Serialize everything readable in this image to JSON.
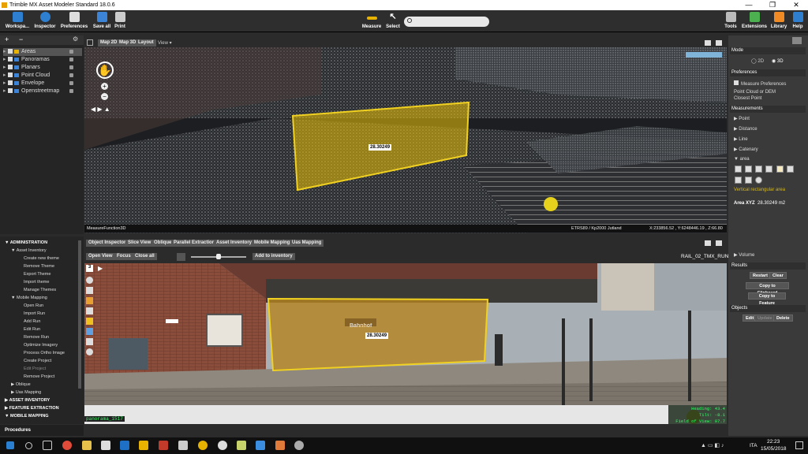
{
  "titlebar": {
    "title": "Trimble MX Asset Modeler Standard 18.0.6",
    "minimize": "—",
    "maximize": "❐",
    "close": "✕"
  },
  "toolbar": {
    "left": [
      "Workspa...",
      "Inspector",
      "Preferences",
      "Save all",
      "Print"
    ],
    "measure": "Measure",
    "select": "Select",
    "search_placeholder": "",
    "right": [
      "Tools",
      "Extensions",
      "Library",
      "Help"
    ]
  },
  "layers": [
    {
      "label": "Areas",
      "selected": true
    },
    {
      "label": "Panoramas"
    },
    {
      "label": "Planars"
    },
    {
      "label": "Point Cloud"
    },
    {
      "label": "Envelope"
    },
    {
      "label": "Openstreetmap"
    }
  ],
  "view3d": {
    "tabs": [
      "Map 2D",
      "Map 3D",
      "Layout"
    ],
    "view_menu": "View",
    "area_label": "28.30249",
    "status_left": "MeasureFunction3D",
    "status_crs": "ETRS89 / Kp2000 Jutland",
    "status_coords": "X:233856.52 , Y:6248446.19 , Z:66.80"
  },
  "right": {
    "mode": "Mode",
    "mode_2d": "2D",
    "mode_3d": "3D",
    "preferences": "Preferences",
    "measure_prefs": "Measure Preferences",
    "pref_line1": "Point Cloud or DEM",
    "pref_line2": "Closest Point",
    "measurements": "Measurements",
    "items": [
      "Point",
      "Distance",
      "Line",
      "Catenary",
      "area"
    ],
    "area_type": "Vertical rectangular area",
    "area_result_label": "Area XYZ",
    "area_result_value": "28.30249 m2",
    "volume": "Volume",
    "results": "Results",
    "restart": "Restart",
    "clear": "Clear",
    "copy_clip": "Copy to Clipboard",
    "copy_feat": "Copy to Feature",
    "objects": "Objects",
    "edit": "Edit",
    "update": "Update",
    "delete": "Delete"
  },
  "tree": [
    {
      "label": "ADMINISTRATION",
      "bold": true,
      "lvl": 0,
      "arrow": "▼"
    },
    {
      "label": "Asset Inventory",
      "lvl": 1,
      "arrow": "▼"
    },
    {
      "label": "Create new theme",
      "lvl": 2
    },
    {
      "label": "Remove Theme",
      "lvl": 2
    },
    {
      "label": "Export Theme",
      "lvl": 2
    },
    {
      "label": "Import theme",
      "lvl": 2
    },
    {
      "label": "Manage Themes",
      "lvl": 2
    },
    {
      "label": "Mobile Mapping",
      "lvl": 1,
      "arrow": "▼"
    },
    {
      "label": "Open Run",
      "lvl": 2
    },
    {
      "label": "Import Run",
      "lvl": 2
    },
    {
      "label": "Add Run",
      "lvl": 2
    },
    {
      "label": "Edit Run",
      "lvl": 2
    },
    {
      "label": "Remove Run",
      "lvl": 2
    },
    {
      "label": "Optimize Imagery",
      "lvl": 2
    },
    {
      "label": "Process Ortho Image",
      "lvl": 2
    },
    {
      "label": "Create Project",
      "lvl": 2
    },
    {
      "label": "Edit Project",
      "lvl": 2
    },
    {
      "label": "Remove Project",
      "lvl": 2
    },
    {
      "label": "Oblique",
      "lvl": 1,
      "arrow": "▶"
    },
    {
      "label": "Uas Mapping",
      "lvl": 1,
      "arrow": "▶"
    },
    {
      "label": "ASSET INVENTORY",
      "bold": true,
      "lvl": 0,
      "arrow": "▶"
    },
    {
      "label": "FEATURE EXTRACTION",
      "bold": true,
      "lvl": 0,
      "arrow": "▶"
    },
    {
      "label": "MOBILE MAPPING",
      "bold": true,
      "lvl": 0,
      "arrow": "▼"
    }
  ],
  "procedures": "Procedures",
  "bottom": {
    "tabs": [
      "Object Inspector",
      "Slice View",
      "Oblique",
      "Parallel Extraction",
      "Asset Inventory",
      "Mobile Mapping",
      "Uas Mapping"
    ],
    "open_view": "Open View",
    "focus": "Focus",
    "close_all": "Close all",
    "add_inventory": "Add to inventory",
    "run_name": "RAIL_02_TMX_RUN",
    "area_label": "28.30249",
    "sign": "Bahnhof",
    "pano_name": "panorama_1517",
    "heading": "Heading: 43.4",
    "tilt": "Tilt: -8.1",
    "fov": "Field of View: 97.7"
  },
  "taskbar": {
    "lang": "ITA",
    "time": "22:23",
    "date": "15/05/2018"
  }
}
